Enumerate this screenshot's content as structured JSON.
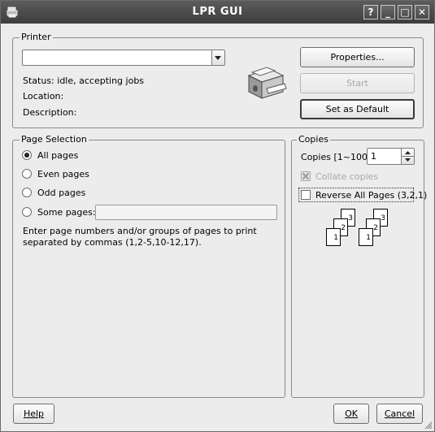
{
  "window": {
    "title": "LPR GUI",
    "controls": {
      "help": "?",
      "minimize": "_",
      "maximize": "□",
      "close": "✕"
    }
  },
  "printer": {
    "group_label": "Printer",
    "selected": "",
    "status_label": "Status:",
    "status_value": "idle, accepting jobs",
    "location_label": "Location:",
    "location_value": "",
    "description_label": "Description:",
    "description_value": "",
    "buttons": {
      "properties": "Properties...",
      "start": "Start",
      "set_default": "Set as Default"
    }
  },
  "page_selection": {
    "group_label": "Page Selection",
    "options": [
      {
        "label": "All pages",
        "checked": true
      },
      {
        "label": "Even pages",
        "checked": false
      },
      {
        "label": "Odd pages",
        "checked": false
      },
      {
        "label": "Some pages:",
        "checked": false
      }
    ],
    "some_pages_value": "",
    "hint": "Enter page numbers and/or groups of pages to print separated by commas (1,2-5,10-12,17)."
  },
  "copies": {
    "group_label": "Copies",
    "copies_label": "Copies [1~100]:",
    "copies_value": "1",
    "collate_label": "Collate copies",
    "collate_checked": true,
    "collate_enabled": false,
    "reverse_label": "Reverse All Pages (3,2,1)",
    "reverse_checked": false,
    "preview_pages": [
      "3",
      "2",
      "1"
    ]
  },
  "footer": {
    "help": "Help",
    "ok": "OK",
    "cancel": "Cancel"
  }
}
